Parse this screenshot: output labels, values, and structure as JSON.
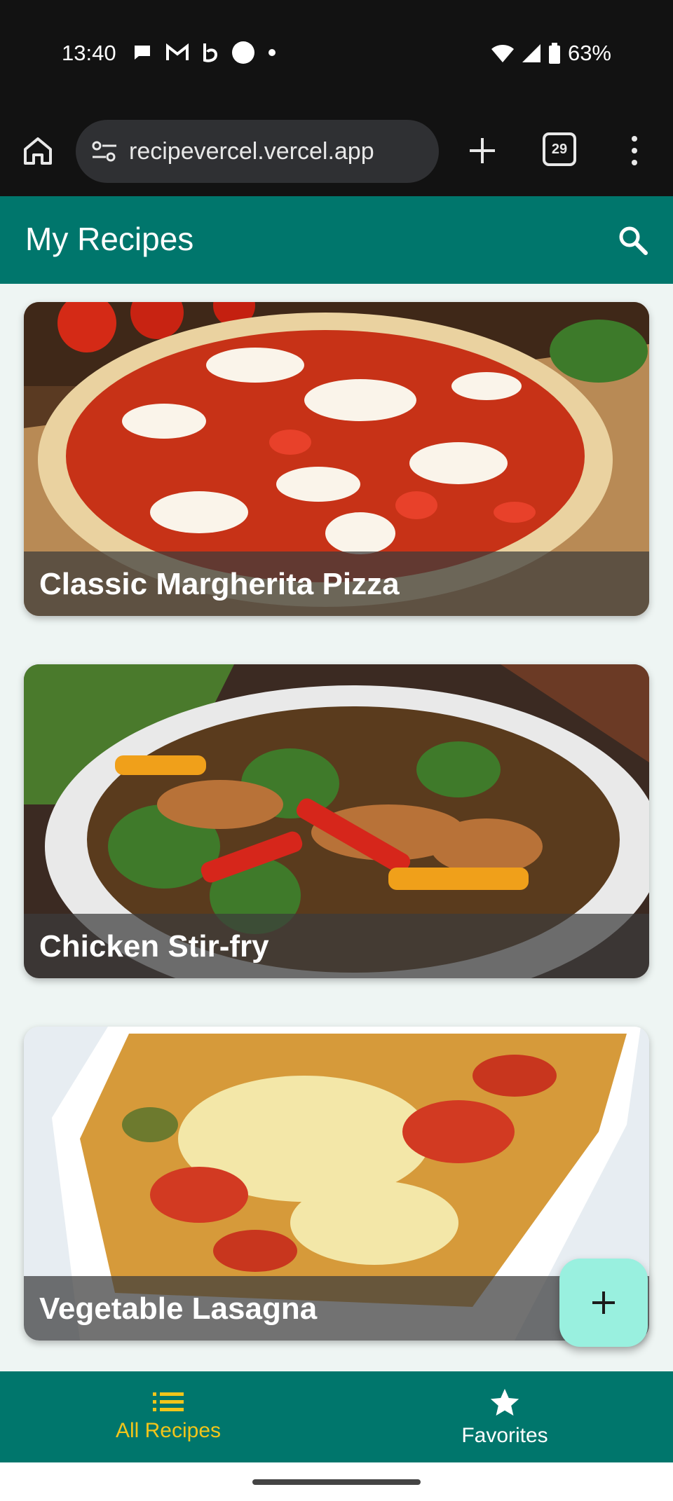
{
  "status_bar": {
    "time": "13:40",
    "battery": "63%",
    "icons": [
      "chat-icon",
      "gmail-icon",
      "b-icon",
      "circle-icon",
      "dot-icon",
      "wifi-icon",
      "signal-icon",
      "battery-icon"
    ]
  },
  "browser": {
    "url": "recipevercel.vercel.app",
    "tab_count": "29"
  },
  "app": {
    "title": "My Recipes",
    "accent_color": "#00766c",
    "fab_color": "#99f0df",
    "active_nav_color": "#f2c51a"
  },
  "recipes": [
    {
      "title": "Classic Margherita Pizza"
    },
    {
      "title": "Chicken Stir-fry"
    },
    {
      "title": "Vegetable Lasagna"
    }
  ],
  "nav": {
    "all_recipes": "All Recipes",
    "favorites": "Favorites"
  }
}
